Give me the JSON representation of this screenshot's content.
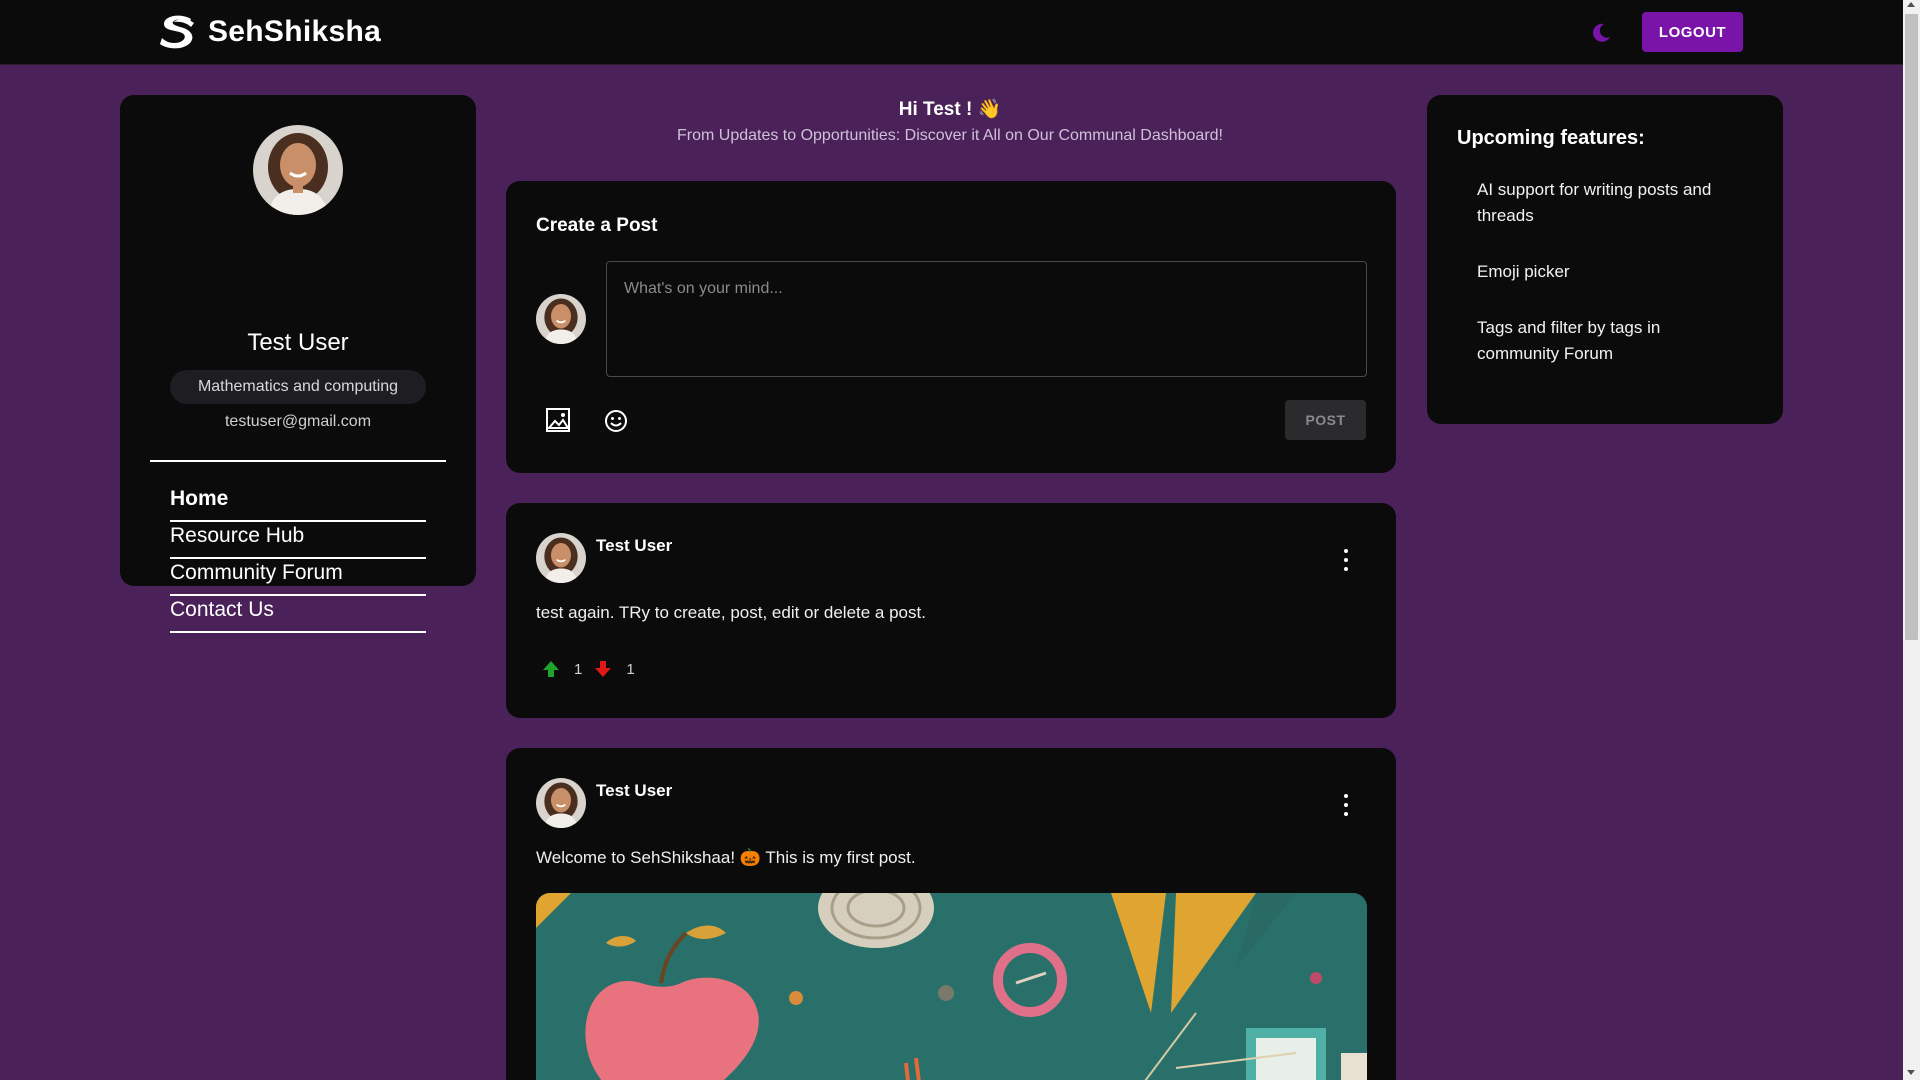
{
  "navbar": {
    "brand": "SehShiksha",
    "logout_label": "LOGOUT",
    "theme_icon": "moon-icon",
    "accent_color": "#7a14a8"
  },
  "profile": {
    "name": "Test User",
    "department": "Mathematics and computing",
    "email": "testuser@gmail.com",
    "nav": [
      {
        "label": "Home",
        "active": true
      },
      {
        "label": "Resource Hub"
      },
      {
        "label": "Community Forum"
      },
      {
        "label": "Contact Us"
      }
    ]
  },
  "greeting": {
    "hi": "Hi Test ! 👋",
    "tagline": "From Updates to Opportunities: Discover it All on Our Communal Dashboard!"
  },
  "create_post": {
    "title": "Create a Post",
    "placeholder": "What's on your mind...",
    "post_label": "POST",
    "tools": [
      "image-icon",
      "emoji-icon"
    ]
  },
  "posts": [
    {
      "author": "Test User",
      "text": "test again. TRy to create, post, edit or delete a post.",
      "upvotes": "1",
      "downvotes": "1"
    },
    {
      "author": "Test User",
      "text": "Welcome to SehShikshaa! 🎃 This is my first post.",
      "has_image": true
    }
  ],
  "features": {
    "title": "Upcoming features:",
    "items": [
      "AI support for writing posts and threads",
      "Emoji picker",
      "Tags and filter by tags in community Forum"
    ]
  },
  "colors": {
    "background": "#4a2259",
    "card": "#0b0b0c",
    "upvote": "#1fa32a",
    "downvote": "#e01818"
  }
}
